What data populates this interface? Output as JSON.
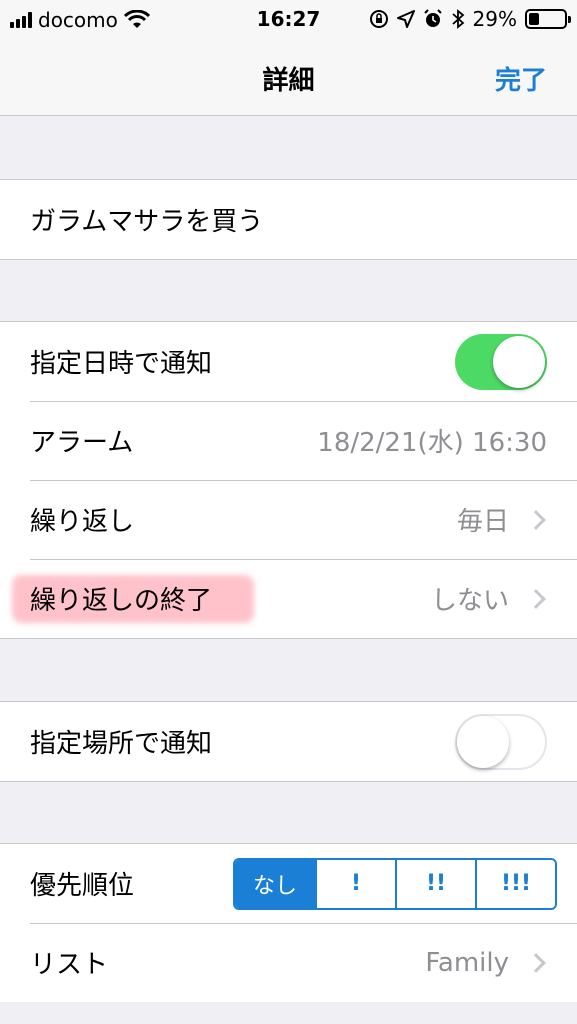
{
  "status_bar": {
    "carrier": "docomo",
    "time": "16:27",
    "battery": "29%",
    "battery_level": 0.29
  },
  "nav": {
    "title": "詳細",
    "done_label": "完了"
  },
  "task": {
    "title": "ガラムマサラを買う"
  },
  "time_group": {
    "notify_time_label": "指定日時で通知",
    "notify_time_on": true,
    "alarm_label": "アラーム",
    "alarm_value": "18/2/21(水) 16:30",
    "repeat_label": "繰り返し",
    "repeat_value": "毎日",
    "repeat_end_label": "繰り返しの終了",
    "repeat_end_value": "しない"
  },
  "location_group": {
    "notify_location_label": "指定場所で通知",
    "notify_location_on": false
  },
  "priority_group": {
    "priority_label": "優先順位",
    "options": [
      "なし",
      "!",
      "!!",
      "!!!"
    ],
    "selected": "なし",
    "list_label": "リスト",
    "list_value": "Family"
  },
  "colors": {
    "accent": "#1a7fd5",
    "toggle_on": "#4cd964",
    "highlight": "#ff788c"
  }
}
